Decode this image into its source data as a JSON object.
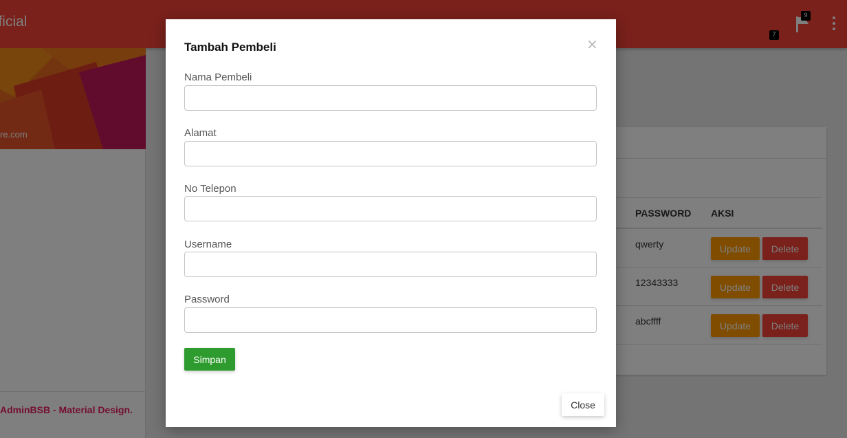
{
  "topbar": {
    "brand": "fficial",
    "flag_badge": "9",
    "small_badge": "7"
  },
  "sidebar": {
    "email": "re.com",
    "footer_text": "AdminBSB - Material Design."
  },
  "table": {
    "headers": {
      "password": "PASSWORD",
      "aksi": "AKSI"
    },
    "rows": [
      {
        "password": "qwerty"
      },
      {
        "password": "12343333"
      },
      {
        "password": "abcffff"
      }
    ],
    "update_label": "Update",
    "delete_label": "Delete"
  },
  "modal": {
    "title": "Tambah Pembeli",
    "close_x": "×",
    "fields": [
      {
        "label": "Nama Pembeli",
        "value": ""
      },
      {
        "label": "Alamat",
        "value": ""
      },
      {
        "label": "No Telepon",
        "value": ""
      },
      {
        "label": "Username",
        "value": ""
      },
      {
        "label": "Password",
        "value": ""
      }
    ],
    "submit_label": "Simpan",
    "close_label": "Close"
  },
  "colors": {
    "header": "#f44336",
    "update_button": "#ff9800",
    "delete_button": "#f44336",
    "submit_button": "#2e9b2e",
    "footer_text": "#e91e63"
  }
}
